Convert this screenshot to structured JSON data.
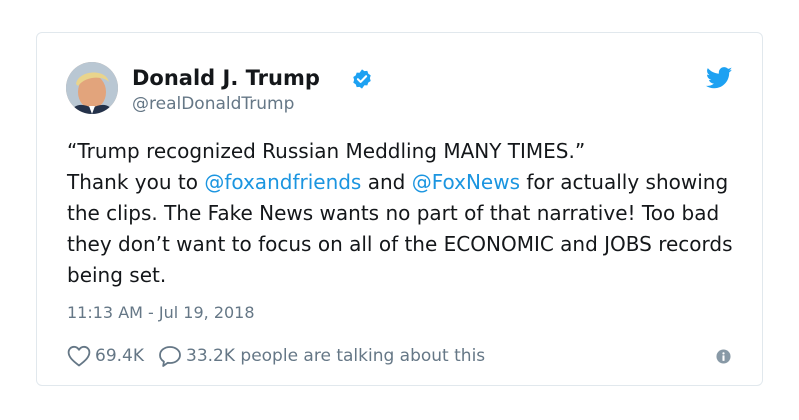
{
  "tweet": {
    "author_name": "Donald J. Trump",
    "author_handle": "@realDonaldTrump",
    "text_segments": {
      "line1": "“Trump recognized Russian Meddling MANY TIMES.”",
      "thank_you": "Thank you to ",
      "mention1": "@foxandfriends",
      "and": " and ",
      "mention2": "@FoxNews",
      "rest": " for actually showing the clips. The Fake News wants no part of that narrative! Too bad they don’t want to focus on all of the ECONOMIC and JOBS records being set."
    },
    "timestamp": "11:13 AM - Jul 19, 2018",
    "likes": "69.4K",
    "conversation": "33.2K people are talking about this"
  },
  "icons": {
    "verified": "verified-badge-icon",
    "brand": "twitter-bird-icon",
    "like": "heart-icon",
    "reply": "speech-bubble-icon",
    "info": "info-icon"
  },
  "colors": {
    "link": "#1b95e0",
    "verified": "#1da1f2",
    "muted": "#657786",
    "text": "#14171a",
    "border": "#e1e8ed"
  }
}
